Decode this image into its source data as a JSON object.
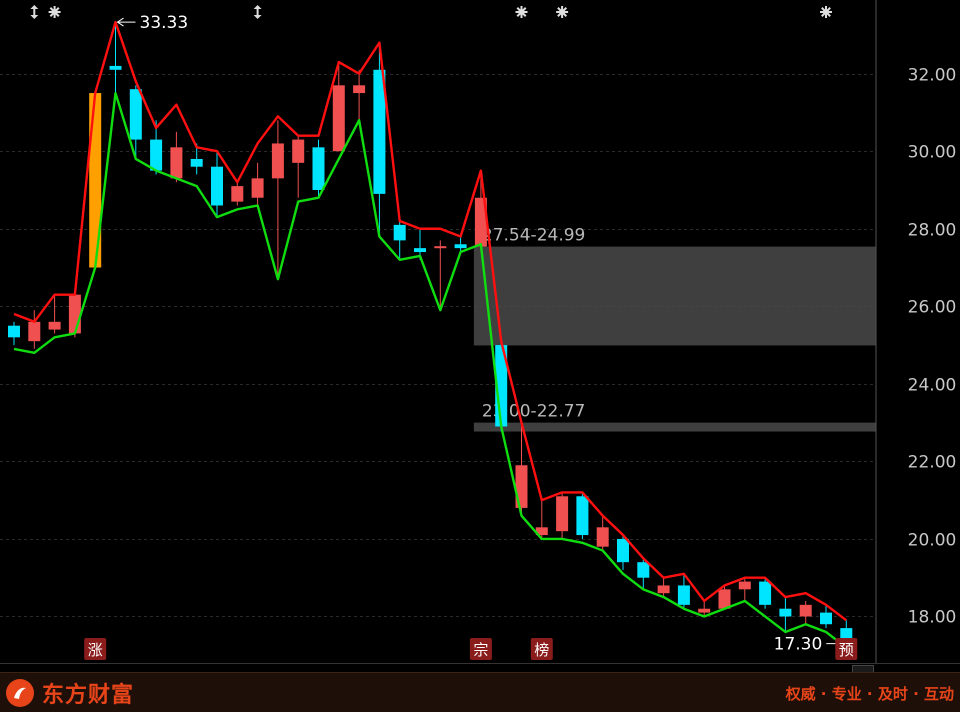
{
  "brand": {
    "name": "东方财富",
    "slogan": "权威 · 专业 · 及时 · 互动"
  },
  "colors": {
    "up": "#f05050",
    "down": "#00e5ff",
    "limit_up": "#ffa000",
    "red_line": "#ff1010",
    "green_line": "#10dd10",
    "zone": "#4a4a4a",
    "axis_text": "#c8c8c8",
    "marker_bg": "#8a1c1c"
  },
  "chart_data": {
    "type": "candlestick",
    "ylim": [
      16.8,
      33.9
    ],
    "yticks": [
      18,
      20,
      22,
      24,
      26,
      28,
      30,
      32
    ],
    "ytick_labels": [
      "18.00",
      "20.00",
      "22.00",
      "24.00",
      "26.00",
      "28.00",
      "30.00",
      "32.00"
    ],
    "grid": true,
    "candles": [
      {
        "o": 25.5,
        "c": 25.2,
        "h": 25.6,
        "l": 25.0
      },
      {
        "o": 25.1,
        "c": 25.6,
        "h": 25.9,
        "l": 24.9
      },
      {
        "o": 25.4,
        "c": 25.6,
        "h": 26.3,
        "l": 25.3
      },
      {
        "o": 25.3,
        "c": 26.3,
        "h": 26.3,
        "l": 25.2
      },
      {
        "o": 27.0,
        "c": 31.5,
        "h": 31.5,
        "l": 27.0,
        "limit_up": true
      },
      {
        "o": 32.2,
        "c": 32.1,
        "h": 33.33,
        "l": 31.5
      },
      {
        "o": 31.6,
        "c": 30.3,
        "h": 31.7,
        "l": 29.8
      },
      {
        "o": 30.3,
        "c": 29.5,
        "h": 30.8,
        "l": 29.4
      },
      {
        "o": 29.3,
        "c": 30.1,
        "h": 30.5,
        "l": 29.2
      },
      {
        "o": 29.8,
        "c": 29.6,
        "h": 30.2,
        "l": 29.4
      },
      {
        "o": 29.6,
        "c": 28.6,
        "h": 30.0,
        "l": 28.3
      },
      {
        "o": 28.7,
        "c": 29.1,
        "h": 29.2,
        "l": 28.6
      },
      {
        "o": 28.8,
        "c": 29.3,
        "h": 29.7,
        "l": 28.6
      },
      {
        "o": 29.3,
        "c": 30.2,
        "h": 30.8,
        "l": 26.7
      },
      {
        "o": 29.7,
        "c": 30.3,
        "h": 30.4,
        "l": 28.8
      },
      {
        "o": 30.1,
        "c": 29.0,
        "h": 30.3,
        "l": 28.8
      },
      {
        "o": 30.0,
        "c": 31.7,
        "h": 32.3,
        "l": 30.0
      },
      {
        "o": 31.5,
        "c": 31.7,
        "h": 32.1,
        "l": 30.8
      },
      {
        "o": 32.1,
        "c": 28.9,
        "h": 32.8,
        "l": 27.8
      },
      {
        "o": 28.1,
        "c": 27.7,
        "h": 28.2,
        "l": 27.2
      },
      {
        "o": 27.5,
        "c": 27.4,
        "h": 28.0,
        "l": 27.2
      },
      {
        "o": 27.55,
        "c": 27.55,
        "h": 27.7,
        "l": 25.9
      },
      {
        "o": 27.6,
        "c": 27.5,
        "h": 27.8,
        "l": 27.4
      },
      {
        "o": 27.54,
        "c": 28.8,
        "h": 29.5,
        "l": 27.4
      },
      {
        "o": 25.0,
        "c": 22.9,
        "h": 25.1,
        "l": 22.77
      },
      {
        "o": 20.8,
        "c": 21.9,
        "h": 23.0,
        "l": 20.6
      },
      {
        "o": 20.1,
        "c": 20.3,
        "h": 21.0,
        "l": 20.0
      },
      {
        "o": 20.2,
        "c": 21.1,
        "h": 21.2,
        "l": 20.0
      },
      {
        "o": 21.1,
        "c": 20.1,
        "h": 21.2,
        "l": 20.0
      },
      {
        "o": 19.8,
        "c": 20.3,
        "h": 20.6,
        "l": 19.7
      },
      {
        "o": 20.0,
        "c": 19.4,
        "h": 20.1,
        "l": 19.2
      },
      {
        "o": 19.4,
        "c": 19.0,
        "h": 19.5,
        "l": 18.7
      },
      {
        "o": 18.6,
        "c": 18.8,
        "h": 19.0,
        "l": 18.5
      },
      {
        "o": 18.8,
        "c": 18.3,
        "h": 19.1,
        "l": 18.2
      },
      {
        "o": 18.1,
        "c": 18.2,
        "h": 18.4,
        "l": 18.0
      },
      {
        "o": 18.2,
        "c": 18.7,
        "h": 18.8,
        "l": 18.2
      },
      {
        "o": 18.7,
        "c": 18.9,
        "h": 19.0,
        "l": 18.4
      },
      {
        "o": 18.9,
        "c": 18.3,
        "h": 19.0,
        "l": 18.2
      },
      {
        "o": 18.2,
        "c": 18.0,
        "h": 18.5,
        "l": 17.6
      },
      {
        "o": 18.0,
        "c": 18.3,
        "h": 18.4,
        "l": 17.8
      },
      {
        "o": 18.1,
        "c": 17.8,
        "h": 18.3,
        "l": 17.7
      },
      {
        "o": 17.7,
        "c": 17.4,
        "h": 17.9,
        "l": 17.3
      }
    ],
    "upper_line": [
      25.8,
      25.6,
      26.3,
      26.3,
      31.5,
      33.33,
      31.8,
      30.6,
      31.2,
      30.1,
      30.0,
      29.2,
      30.2,
      30.9,
      30.4,
      30.4,
      32.3,
      32.0,
      32.8,
      28.2,
      28.0,
      28.0,
      27.8,
      29.5,
      25.1,
      23.0,
      21.0,
      21.2,
      21.2,
      20.6,
      20.1,
      19.5,
      19.0,
      19.1,
      18.4,
      18.8,
      19.0,
      19.0,
      18.5,
      18.6,
      18.3,
      17.9
    ],
    "lower_line": [
      24.9,
      24.8,
      25.2,
      25.3,
      27.0,
      31.5,
      29.8,
      29.5,
      29.3,
      29.1,
      28.3,
      28.5,
      28.6,
      26.7,
      28.7,
      28.8,
      29.8,
      30.8,
      27.8,
      27.2,
      27.3,
      25.9,
      27.4,
      27.6,
      22.9,
      20.6,
      20.0,
      20.0,
      19.9,
      19.7,
      19.1,
      18.7,
      18.5,
      18.2,
      18.0,
      18.2,
      18.4,
      18.0,
      17.6,
      17.8,
      17.6,
      17.2
    ],
    "zones": [
      {
        "label": "27.54-24.99",
        "top": 27.54,
        "bottom": 24.99
      },
      {
        "label": "23.00-22.77",
        "top": 23.0,
        "bottom": 22.77
      }
    ],
    "annotations": [
      {
        "text": "33.33",
        "candle": 5,
        "value": 33.33,
        "side": "right"
      },
      {
        "text": "17.30",
        "candle": 41,
        "value": 17.3,
        "side": "left"
      }
    ],
    "badges": [
      {
        "text": "涨",
        "candle": 4
      },
      {
        "text": "宗",
        "candle": 23
      },
      {
        "text": "榜",
        "candle": 26
      },
      {
        "text": "预",
        "candle": 41
      }
    ],
    "top_icons": [
      {
        "icon": "split-arrow-icon",
        "candle": 1
      },
      {
        "icon": "gear-icon",
        "candle": 2
      },
      {
        "icon": "split-arrow-icon",
        "candle": 12
      },
      {
        "icon": "gear-icon",
        "candle": 25
      },
      {
        "icon": "gear-icon",
        "candle": 27
      },
      {
        "icon": "gear-icon",
        "candle": 40
      }
    ]
  }
}
